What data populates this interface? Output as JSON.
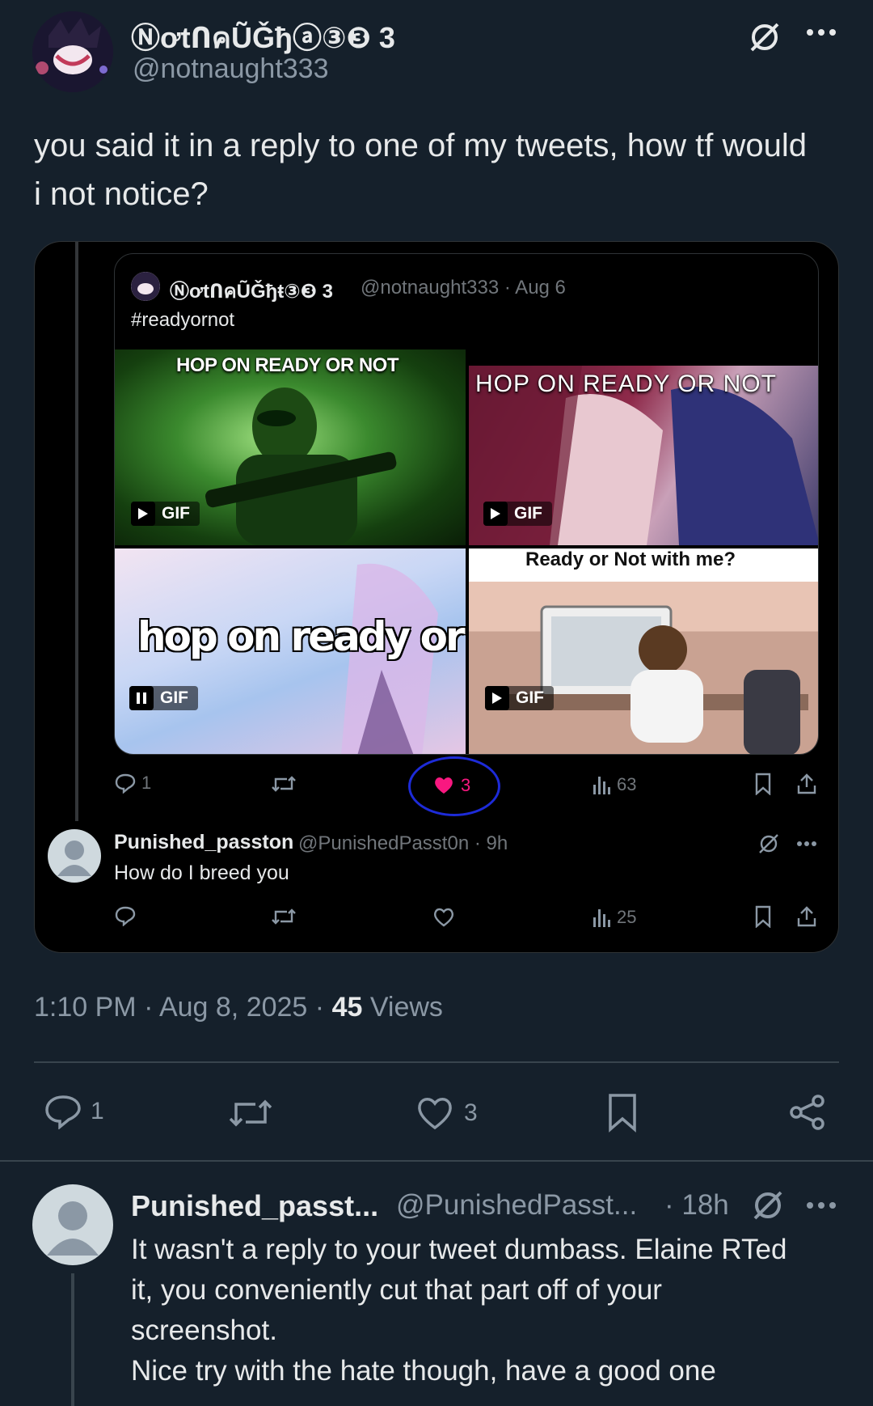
{
  "tweet": {
    "display_name": "ⓃơtՈคŨǦђⓐ③❸ 3",
    "handle": "@notnaught333",
    "text": "you said it in a reply to one of my tweets, how tf would i not notice?",
    "timestamp": "1:10 PM · Aug 8, 2025 · ",
    "views_count": "45",
    "views_label": " Views",
    "replies": "1",
    "likes": "3"
  },
  "screenshot": {
    "quoted": {
      "display_name": "ⓃơtՈคŨǦђŧ③❸ 3",
      "handle_date": "@notnaught333 · Aug 6",
      "text": "#readyornot",
      "gifs": [
        {
          "caption": "HOP ON READY OR NOT",
          "badge": "GIF",
          "state": "play"
        },
        {
          "caption": "HOP ON READY OR NOT",
          "badge": "GIF",
          "state": "play"
        },
        {
          "caption": "hop on ready or not",
          "badge": "GIF",
          "state": "pause"
        },
        {
          "caption": "Ready or Not with me?",
          "badge": "GIF",
          "state": "play"
        }
      ],
      "replies": "1",
      "likes": "3",
      "views": "63"
    },
    "reply": {
      "display_name": "Punished_passton",
      "handle_date": "@PunishedPasst0n · 9h",
      "text": "How do I breed you",
      "views": "25"
    }
  },
  "response": {
    "display_name": "Punished_passt...",
    "handle": "@PunishedPasst...",
    "time": "· 18h",
    "lines": [
      "It wasn't a reply to your tweet dumbass. Elaine RTed",
      "it, you conveniently cut that part off of your",
      "screenshot.",
      "Nice try with the hate though, have a good one"
    ]
  },
  "colors": {
    "background": "#15202b",
    "muted": "#8b98a5",
    "like_pink": "#f91880",
    "highlight_circle": "#1d2bd8"
  }
}
